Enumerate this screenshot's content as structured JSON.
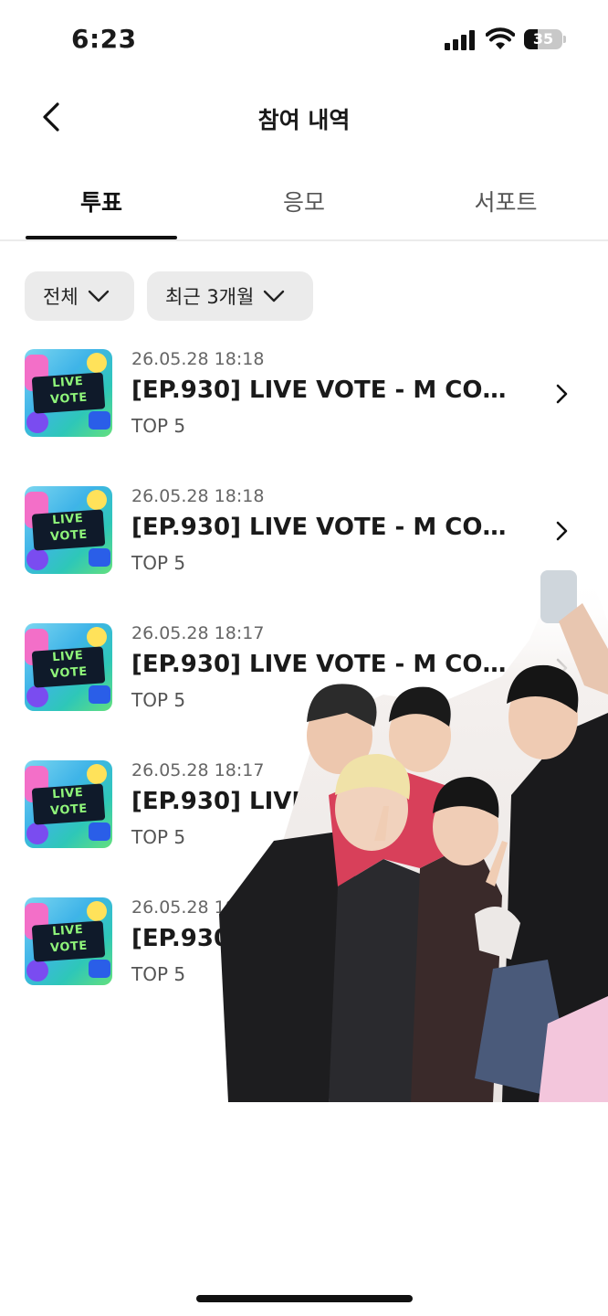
{
  "status_bar": {
    "time": "6:23",
    "battery": "35"
  },
  "header": {
    "title": "참여 내역"
  },
  "tabs": [
    {
      "label": "투표",
      "active": true
    },
    {
      "label": "응모",
      "active": false
    },
    {
      "label": "서포트",
      "active": false
    }
  ],
  "filters": {
    "category": "전체",
    "period": "최근 3개월"
  },
  "thumb_badge": {
    "line1": "LIVE",
    "line2": "VOTE"
  },
  "items": [
    {
      "date": "26.05.28 18:18",
      "title": "[EP.930] LIVE VOTE - M COUN...",
      "rank": "TOP 5"
    },
    {
      "date": "26.05.28 18:18",
      "title": "[EP.930] LIVE VOTE - M COUN...",
      "rank": "TOP 5"
    },
    {
      "date": "26.05.28 18:17",
      "title": "[EP.930] LIVE VOTE - M COUN...",
      "rank": "TOP 5"
    },
    {
      "date": "26.05.28 18:17",
      "title": "[EP.930] LIVE VOTE - M COUN...",
      "rank": "TOP 5"
    },
    {
      "date": "26.05.28 18:17",
      "title": "[EP.930] LIVE VOTE - M COUN...",
      "rank": "TOP 5"
    }
  ],
  "icons": {
    "back": "chevron-left-icon",
    "dropdown": "chevron-down-icon",
    "row_arrow": "chevron-right-icon"
  }
}
